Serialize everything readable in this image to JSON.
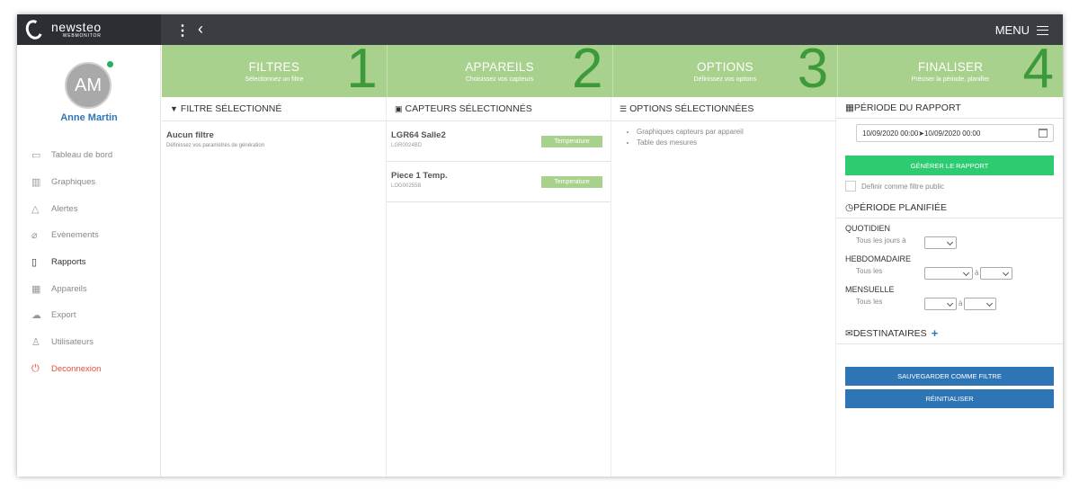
{
  "app": {
    "logo_name": "newsteo",
    "logo_sub": "WEBMONITOR",
    "menu_label": "MENU"
  },
  "user": {
    "initials": "AM",
    "name": "Anne Martin"
  },
  "sidebar": {
    "items": [
      {
        "label": "Tableau de bord",
        "icon": "monitor-icon"
      },
      {
        "label": "Graphiques",
        "icon": "bar-chart-icon"
      },
      {
        "label": "Alertes",
        "icon": "bell-icon"
      },
      {
        "label": "Evènements",
        "icon": "paperclip-icon"
      },
      {
        "label": "Rapports",
        "icon": "document-icon"
      },
      {
        "label": "Appareils",
        "icon": "grid-icon"
      },
      {
        "label": "Export",
        "icon": "cloud-upload-icon"
      },
      {
        "label": "Utilisateurs",
        "icon": "user-icon"
      },
      {
        "label": "Deconnexion",
        "icon": "power-icon"
      }
    ]
  },
  "steps": [
    {
      "title": "FILTRES",
      "sub": "Sélectionnez un filtre",
      "num": "1"
    },
    {
      "title": "APPAREILS",
      "sub": "Choisissez vos capteurs",
      "num": "2"
    },
    {
      "title": "OPTIONS",
      "sub": "Définissez vos options",
      "num": "3"
    },
    {
      "title": "FINALISER",
      "sub": "Préciser la période, planifier",
      "num": "4"
    }
  ],
  "filters": {
    "heading": "FILTRE SÉLECTIONNÉ",
    "title": "Aucun filtre",
    "sub": "Définissez vos paramètres de génération"
  },
  "sensors": {
    "heading": "CAPTEURS SÉLECTIONNÉS",
    "items": [
      {
        "name": "LGR64 Salle2",
        "id": "LGR0024BD",
        "tag": "Temperature"
      },
      {
        "name": "Piece 1 Temp.",
        "id": "LOG00255B",
        "tag": "Temperature"
      }
    ]
  },
  "options": {
    "heading": "OPTIONS SÉLECTIONNÉES",
    "items": [
      "Graphiques capteurs par appareil",
      "Table des mesures"
    ]
  },
  "finalize": {
    "period_heading": "PÉRIODE DU RAPPORT",
    "date_range": "10/09/2020 00:00➤10/09/2020 00:00",
    "generate_label": "GÉNÉRER LE RAPPORT",
    "public_label": "Definir comme filtre public",
    "planned_heading": "PÉRIODE PLANIFIÉE",
    "daily": {
      "label": "QUOTIDIEN",
      "text": "Tous les jours à"
    },
    "weekly": {
      "label": "HEBDOMADAIRE",
      "text": "Tous les",
      "sep": "à"
    },
    "monthly": {
      "label": "MENSUELLE",
      "text": "Tous les",
      "sep": "à"
    },
    "recipients_heading": "DESTINATAIRES",
    "save_label": "SAUVEGARDER COMME FILTRE",
    "reset_label": "RÉINITIALISER"
  },
  "colors": {
    "step_bg": "#a9d18e",
    "step_number": "#3c9a3a",
    "generate_button": "#2ecc71",
    "primary_button": "#2e75b6",
    "logout": "#e74c3c"
  }
}
